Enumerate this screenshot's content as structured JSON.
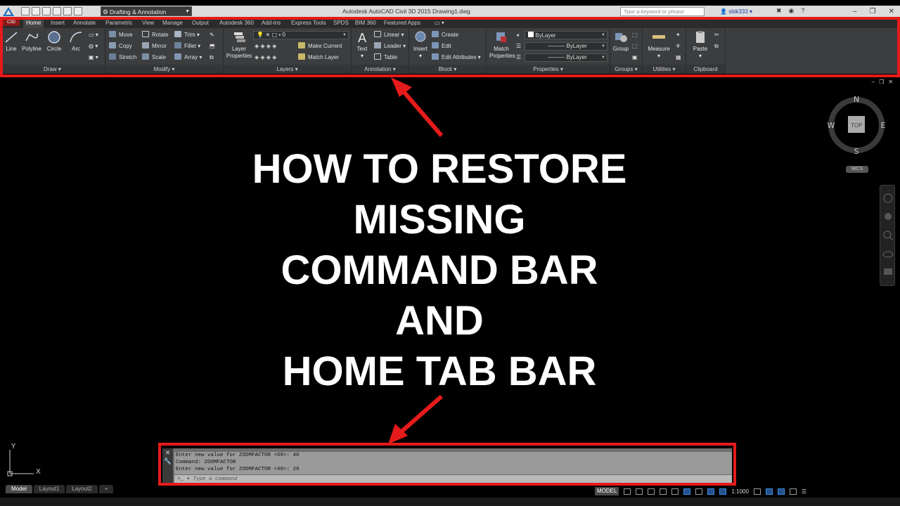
{
  "titlebar": {
    "workspace": "Drafting & Annotation",
    "title": "Autodesk AutoCAD Civil 3D 2015    Drawing1.dwg",
    "search_placeholder": "Type a keyword or phrase",
    "user": "sbik333"
  },
  "ribbon": {
    "app_button": "C3D",
    "tabs": [
      "Home",
      "Insert",
      "Annotate",
      "Parametric",
      "View",
      "Manage",
      "Output",
      "Autodesk 360",
      "Add-ins",
      "Express Tools",
      "SPDS",
      "BIM 360",
      "Featured Apps"
    ],
    "panels": {
      "draw": {
        "title": "Draw",
        "line": "Line",
        "polyline": "Polyline",
        "circle": "Circle",
        "arc": "Arc"
      },
      "modify": {
        "title": "Modify",
        "move": "Move",
        "rotate": "Rotate",
        "trim": "Trim",
        "copy": "Copy",
        "mirror": "Mirror",
        "fillet": "Fillet",
        "stretch": "Stretch",
        "scale": "Scale",
        "array": "Array"
      },
      "layers": {
        "title": "Layers",
        "layer_properties_1": "Layer",
        "layer_properties_2": "Properties",
        "layer_combo": "0",
        "make_current": "Make Current",
        "match_layer": "Match Layer"
      },
      "annotation": {
        "title": "Annotation",
        "text": "Text",
        "linear": "Linear",
        "leader": "Leader",
        "table": "Table"
      },
      "block": {
        "title": "Block",
        "insert": "Insert",
        "create": "Create",
        "edit": "Edit",
        "edit_attributes": "Edit Attributes"
      },
      "properties": {
        "title": "Properties",
        "match_1": "Match",
        "match_2": "Properties",
        "color": "ByLayer",
        "linetype": "ByLayer",
        "lineweight": "ByLayer"
      },
      "groups": {
        "title": "Groups",
        "group": "Group"
      },
      "utilities": {
        "title": "Utilities",
        "measure": "Measure"
      },
      "clipboard": {
        "title": "Clipboard",
        "paste": "Paste"
      }
    }
  },
  "headline": [
    "HOW TO RESTORE",
    "MISSING",
    "COMMAND BAR",
    "AND",
    "HOME TAB BAR"
  ],
  "viewcube": {
    "face": "TOP",
    "n": "N",
    "s": "S",
    "e": "E",
    "w": "W",
    "wcs": "WCS"
  },
  "ucs": {
    "x": "X",
    "y": "Y"
  },
  "command_line": {
    "history": [
      "Enter new value for ZOOMFACTOR <60>: 40",
      "Command: ZOOMFACTOR",
      "Enter new value for ZOOMFACTOR <40>: 20"
    ],
    "prompt": "Type a command"
  },
  "layout_tabs": [
    "Model",
    "Layout1",
    "Layout2",
    "+"
  ],
  "statusbar": {
    "model": "MODEL",
    "scale": "1:1000"
  },
  "colors": {
    "highlight": "#e51b1b",
    "ribbon_bg": "#3b3d3f",
    "canvas": "#000000"
  }
}
